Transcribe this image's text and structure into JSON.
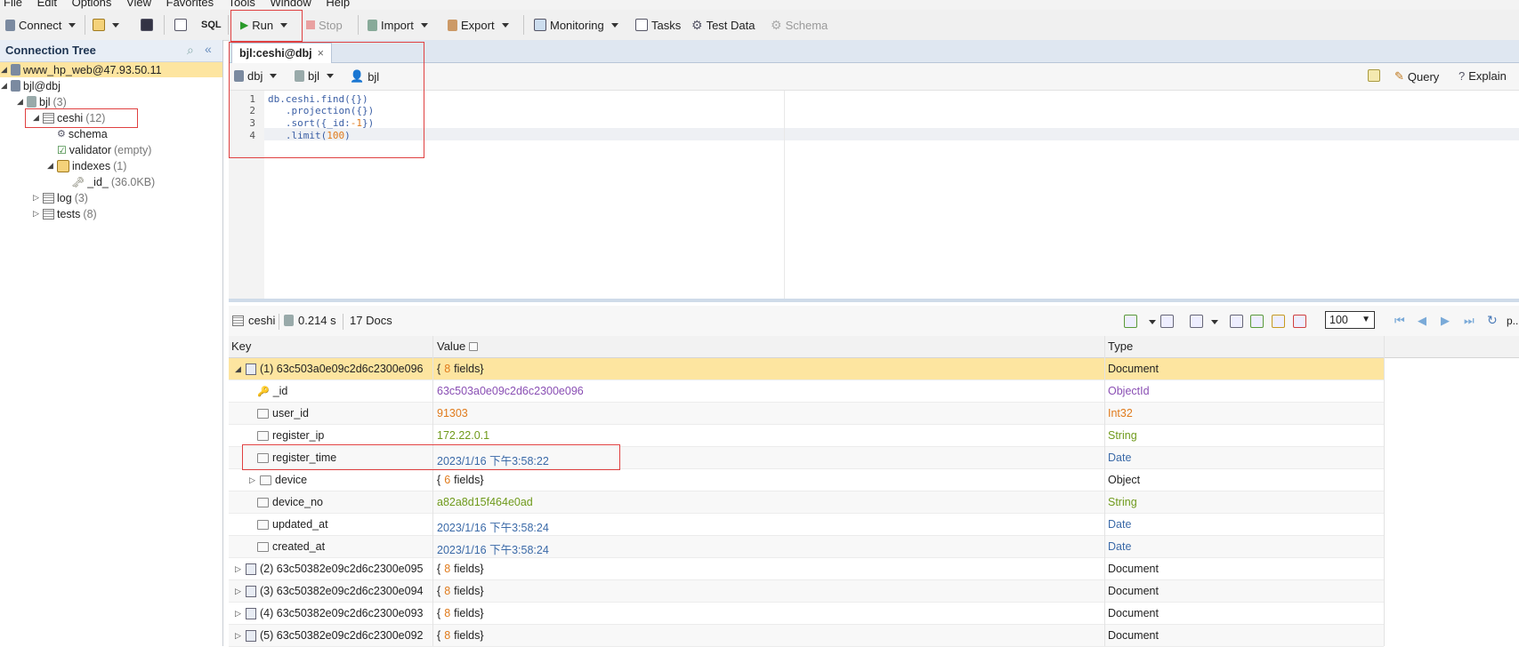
{
  "menu": [
    "File",
    "Edit",
    "Options",
    "View",
    "Favorites",
    "Tools",
    "Window",
    "Help"
  ],
  "toolbar": {
    "connect": "Connect",
    "sql": "SQL",
    "run": "Run",
    "stop": "Stop",
    "import": "Import",
    "export": "Export",
    "monitoring": "Monitoring",
    "tasks": "Tasks",
    "test_data": "Test Data",
    "schema": "Schema"
  },
  "left_panel": {
    "title": "Connection Tree",
    "tree": [
      {
        "label": "www_hp_web@47.93.50.11",
        "count": ""
      },
      {
        "label": "bjl@dbj",
        "count": ""
      },
      {
        "label": "bjl",
        "count": "(3)"
      },
      {
        "label": "ceshi",
        "count": "(12)"
      },
      {
        "label": "schema",
        "count": ""
      },
      {
        "label": "validator",
        "count": "(empty)"
      },
      {
        "label": "indexes",
        "count": "(1)"
      },
      {
        "label": "_id_",
        "count": "(36.0KB)"
      },
      {
        "label": "log",
        "count": "(3)"
      },
      {
        "label": "tests",
        "count": "(8)"
      }
    ]
  },
  "tab": {
    "label": "bjl:ceshi@dbj",
    "close": "×"
  },
  "editor_bar": {
    "db": "dbj",
    "collection": "bjl",
    "user": "bjl",
    "query": "Query",
    "explain": "Explain"
  },
  "editor": {
    "lines": [
      {
        "n": "1",
        "code": "db.ceshi.find({})"
      },
      {
        "n": "2",
        "code": "   .projection({})"
      },
      {
        "n": "3",
        "code": "   .sort({_id:-1})"
      },
      {
        "n": "4",
        "code": "   .limit(100)"
      }
    ]
  },
  "results": {
    "collection": "ceshi",
    "time": "0.214 s",
    "docs": "17 Docs",
    "page_size": "100",
    "page_label": "p..."
  },
  "grid": {
    "headers": {
      "key": "Key",
      "value": "Value",
      "type": "Type"
    },
    "rows": [
      {
        "key": "(1) 63c503a0e09c2d6c2300e096",
        "value": "{8 fields}",
        "type": "Document",
        "vcolor": "#222",
        "tcolor": "#222"
      },
      {
        "key": "_id",
        "value": "63c503a0e09c2d6c2300e096",
        "type": "ObjectId",
        "vcolor": "#8a4fb4",
        "tcolor": "#8a4fb4"
      },
      {
        "key": "user_id",
        "value": "91303",
        "type": "Int32",
        "vcolor": "#e07b1c",
        "tcolor": "#e07b1c"
      },
      {
        "key": "register_ip",
        "value": "172.22.0.1",
        "type": "String",
        "vcolor": "#6f9a1b",
        "tcolor": "#6f9a1b"
      },
      {
        "key": "register_time",
        "value": "2023/1/16 下午3:58:22",
        "type": "Date",
        "vcolor": "#3b6aa8",
        "tcolor": "#3b6aa8"
      },
      {
        "key": "device",
        "value": "{6 fields}",
        "type": "Object",
        "vcolor": "#222",
        "tcolor": "#222"
      },
      {
        "key": "device_no",
        "value": "a82a8d15f464e0ad",
        "type": "String",
        "vcolor": "#6f9a1b",
        "tcolor": "#6f9a1b"
      },
      {
        "key": "updated_at",
        "value": "2023/1/16 下午3:58:24",
        "type": "Date",
        "vcolor": "#3b6aa8",
        "tcolor": "#3b6aa8"
      },
      {
        "key": "created_at",
        "value": "2023/1/16 下午3:58:24",
        "type": "Date",
        "vcolor": "#3b6aa8",
        "tcolor": "#3b6aa8"
      },
      {
        "key": "(2) 63c50382e09c2d6c2300e095",
        "value": "{8 fields}",
        "type": "Document",
        "vcolor": "#222",
        "tcolor": "#222"
      },
      {
        "key": "(3) 63c50382e09c2d6c2300e094",
        "value": "{8 fields}",
        "type": "Document",
        "vcolor": "#222",
        "tcolor": "#222"
      },
      {
        "key": "(4) 63c50382e09c2d6c2300e093",
        "value": "{8 fields}",
        "type": "Document",
        "vcolor": "#222",
        "tcolor": "#222"
      },
      {
        "key": "(5) 63c50382e09c2d6c2300e092",
        "value": "{8 fields}",
        "type": "Document",
        "vcolor": "#222",
        "tcolor": "#222"
      }
    ]
  },
  "colors": {
    "selection": "#fde5a0",
    "accent": "#e04040",
    "code": "#3b5fa5"
  }
}
